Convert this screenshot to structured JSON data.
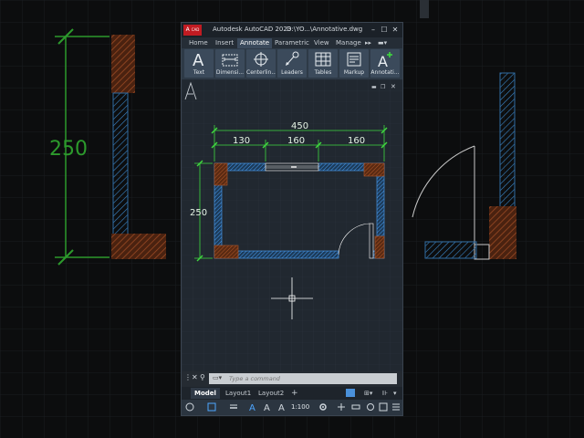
{
  "window": {
    "app_title": "Autodesk AutoCAD 2023",
    "file_title": "D:\\YO...\\Annotative.dwg",
    "logo_text": "CAD",
    "logo_letter": "A"
  },
  "ribbon_tabs": [
    "Home",
    "Insert",
    "Annotate",
    "Parametric",
    "View",
    "Manage"
  ],
  "active_tab": "Annotate",
  "ribbon_buttons": [
    {
      "label": "Text",
      "icon": "text-icon"
    },
    {
      "label": "Dimensi...",
      "icon": "dimension-icon"
    },
    {
      "label": "Centerlin...",
      "icon": "centerline-icon"
    },
    {
      "label": "Leaders",
      "icon": "leader-icon"
    },
    {
      "label": "Tables",
      "icon": "table-icon"
    },
    {
      "label": "Markup",
      "icon": "markup-icon"
    },
    {
      "label": "Annotati...",
      "icon": "annotation-scaling-icon"
    }
  ],
  "drawing": {
    "dim_overall": "450",
    "dim_left": "130",
    "dim_middle": "160",
    "dim_right": "160",
    "dim_height": "250"
  },
  "background": {
    "dim_height": "250"
  },
  "command": {
    "placeholder": "Type a command"
  },
  "layout_tabs": [
    "Model",
    "Layout1",
    "Layout2"
  ],
  "active_layout": "Model",
  "status": {
    "scale": "1:100"
  },
  "colors": {
    "dimension": "#3fd93f",
    "wall": "#4da6ff",
    "column": "#b0582b",
    "cursor": "#ffffff",
    "viewport_bg": "#212830"
  }
}
